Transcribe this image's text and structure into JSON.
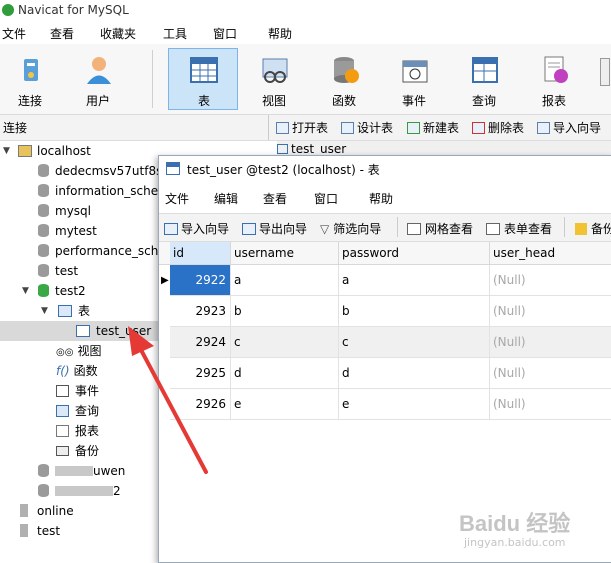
{
  "app": {
    "title": "Navicat for MySQL"
  },
  "menubar": [
    "文件",
    "查看",
    "收藏夹",
    "工具",
    "窗口",
    "帮助"
  ],
  "toolbar": [
    {
      "label": "连接",
      "icon": "connection-icon"
    },
    {
      "label": "用户",
      "icon": "user-icon"
    },
    {
      "label": "表",
      "icon": "table-icon",
      "selected": true
    },
    {
      "label": "视图",
      "icon": "view-icon"
    },
    {
      "label": "函数",
      "icon": "function-icon"
    },
    {
      "label": "事件",
      "icon": "event-icon"
    },
    {
      "label": "查询",
      "icon": "query-icon"
    },
    {
      "label": "报表",
      "icon": "report-icon"
    }
  ],
  "connbar": {
    "label": "连接",
    "buttons": [
      "打开表",
      "设计表",
      "新建表",
      "删除表",
      "导入向导"
    ],
    "tab_label": "test_user"
  },
  "tree": {
    "root": "localhost",
    "databases": [
      "dedecmsv57utf8s",
      "information_sche",
      "mysql",
      "mytest",
      "performance_sch",
      "test",
      "test2"
    ],
    "test2_children": {
      "tables_label": "表",
      "table": "test_user",
      "others": [
        "视图",
        "函数",
        "事件",
        "查询",
        "报表",
        "备份"
      ]
    },
    "blurred": [
      "uwen",
      "2"
    ],
    "other_connections": [
      "online",
      "test"
    ]
  },
  "window": {
    "title": "test_user @test2 (localhost) - 表",
    "menu": [
      "文件",
      "编辑",
      "查看",
      "窗口",
      "帮助"
    ],
    "toolbar": [
      "导入向导",
      "导出向导",
      "筛选向导",
      "网格查看",
      "表单查看",
      "备份"
    ],
    "columns": [
      "id",
      "username",
      "password",
      "user_head"
    ],
    "rows": [
      {
        "id": "2922",
        "username": "a",
        "password": "a",
        "user_head": "(Null)"
      },
      {
        "id": "2923",
        "username": "b",
        "password": "b",
        "user_head": "(Null)"
      },
      {
        "id": "2924",
        "username": "c",
        "password": "c",
        "user_head": "(Null)"
      },
      {
        "id": "2925",
        "username": "d",
        "password": "d",
        "user_head": "(Null)"
      },
      {
        "id": "2926",
        "username": "e",
        "password": "e",
        "user_head": "(Null)"
      }
    ]
  },
  "watermark": {
    "text": "Baidu 经验",
    "url_text": "jingyan.baidu.com"
  },
  "colors": {
    "selected_cell": "#2a72c8",
    "arrow": "#e53935",
    "toolbar_selected": "#cce4f7"
  }
}
